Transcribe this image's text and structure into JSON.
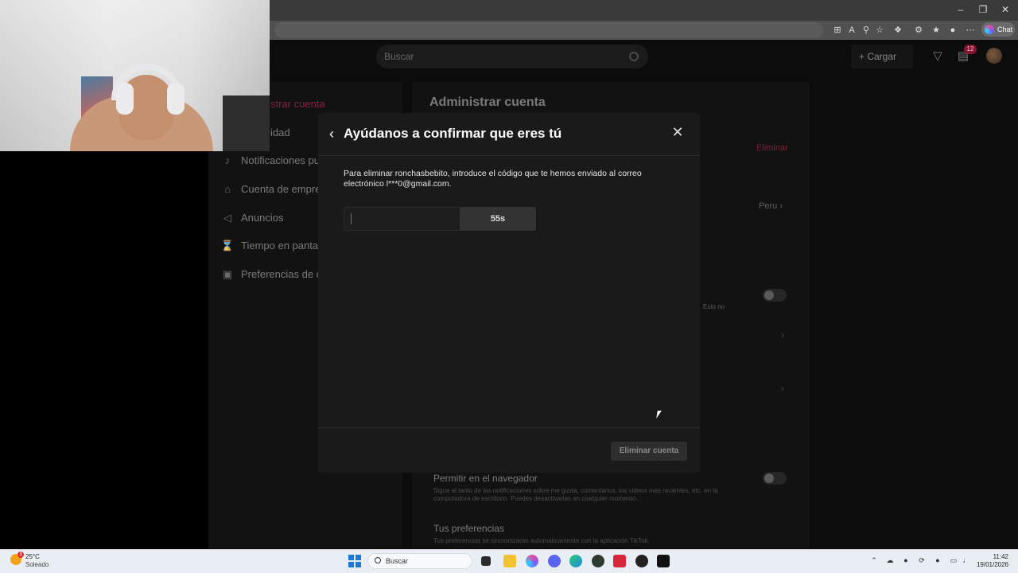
{
  "browser": {
    "chat_label": "Chat"
  },
  "topnav": {
    "search_placeholder": "Buscar",
    "upload_label": "Cargar",
    "inbox_badge": "12"
  },
  "sidebar": {
    "active_partial": "strar cuenta",
    "privacy_partial": "idad",
    "items": [
      {
        "label": "Notificaciones pu",
        "icon": "bell-icon"
      },
      {
        "label": "Cuenta de empre",
        "icon": "shop-icon"
      },
      {
        "label": "Anuncios",
        "icon": "megaphone-icon"
      },
      {
        "label": "Tiempo en panta",
        "icon": "hourglass-icon"
      },
      {
        "label": "Preferencias de c",
        "icon": "video-icon"
      }
    ]
  },
  "settings": {
    "title": "Administrar cuenta",
    "delete_link": "Eliminar",
    "region_value": "Peru",
    "note_partial": "Esto no",
    "browser_heading": "Permitir en el navegador",
    "browser_desc": "Sigue al tanto de las notificaciones sobre me gusta, comentarios, los videos más recientes, etc. en la computadora de escritorio. Puedes desactivarlas en cualquier momento.",
    "prefs_heading": "Tus preferencias",
    "prefs_desc": "Tus preferencias se sincronizarán automáticamente con la aplicación TikTok."
  },
  "modal": {
    "title": "Ayúdanos a confirmar que eres tú",
    "instruction": "Para eliminar ronchasbebito, introduce el código que te hemos enviado al correo electrónico l***0@gmail.com.",
    "code_value": "",
    "timer_label": "55s",
    "submit_label": "Eliminar cuenta"
  },
  "taskbar": {
    "weather_temp": "25°C",
    "weather_condition": "Soleado",
    "weather_badge": "3",
    "search_label": "Buscar",
    "time": "11:42",
    "date": "19/01/2026"
  }
}
